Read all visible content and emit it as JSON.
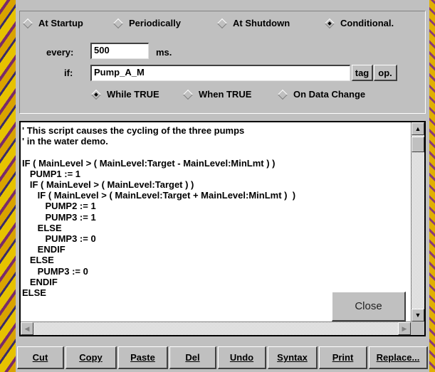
{
  "trigger": {
    "options": [
      {
        "label": "At Startup",
        "selected": false
      },
      {
        "label": "Periodically",
        "selected": false
      },
      {
        "label": "At Shutdown",
        "selected": false
      },
      {
        "label": "Conditional.",
        "selected": true
      }
    ],
    "every_label": "every:",
    "every_value": "500",
    "every_unit": "ms.",
    "if_label": "if:",
    "if_value": "Pump_A_M",
    "tag_button": "tag",
    "op_button": "op.",
    "conditions": [
      {
        "label": "While TRUE",
        "selected": true
      },
      {
        "label": "When TRUE",
        "selected": false
      },
      {
        "label": "On Data Change",
        "selected": false
      }
    ]
  },
  "script": {
    "lines": [
      "' This script causes the cycling of the three pumps",
      "' in the water demo.",
      "",
      "IF ( MainLevel > ( MainLevel:Target - MainLevel:MinLmt ) )",
      "   PUMP1 := 1",
      "   IF ( MainLevel > ( MainLevel:Target ) )",
      "      IF ( MainLevel > ( MainLevel:Target + MainLevel:MinLmt )  )",
      "         PUMP2 := 1",
      "         PUMP3 := 1",
      "      ELSE",
      "         PUMP3 := 0",
      "      ENDIF",
      "   ELSE",
      "      PUMP3 := 0",
      "   ENDIF",
      "ELSE"
    ]
  },
  "close_button": "Close",
  "toolbar": {
    "buttons": [
      "Cut",
      "Copy",
      "Paste",
      "Del",
      "Undo",
      "Syntax",
      "Print",
      "Replace..."
    ]
  },
  "icons": {
    "scroll_up": "arrow-up-icon",
    "scroll_down": "arrow-down-icon",
    "scroll_left": "arrow-left-icon",
    "scroll_right": "arrow-right-icon"
  }
}
